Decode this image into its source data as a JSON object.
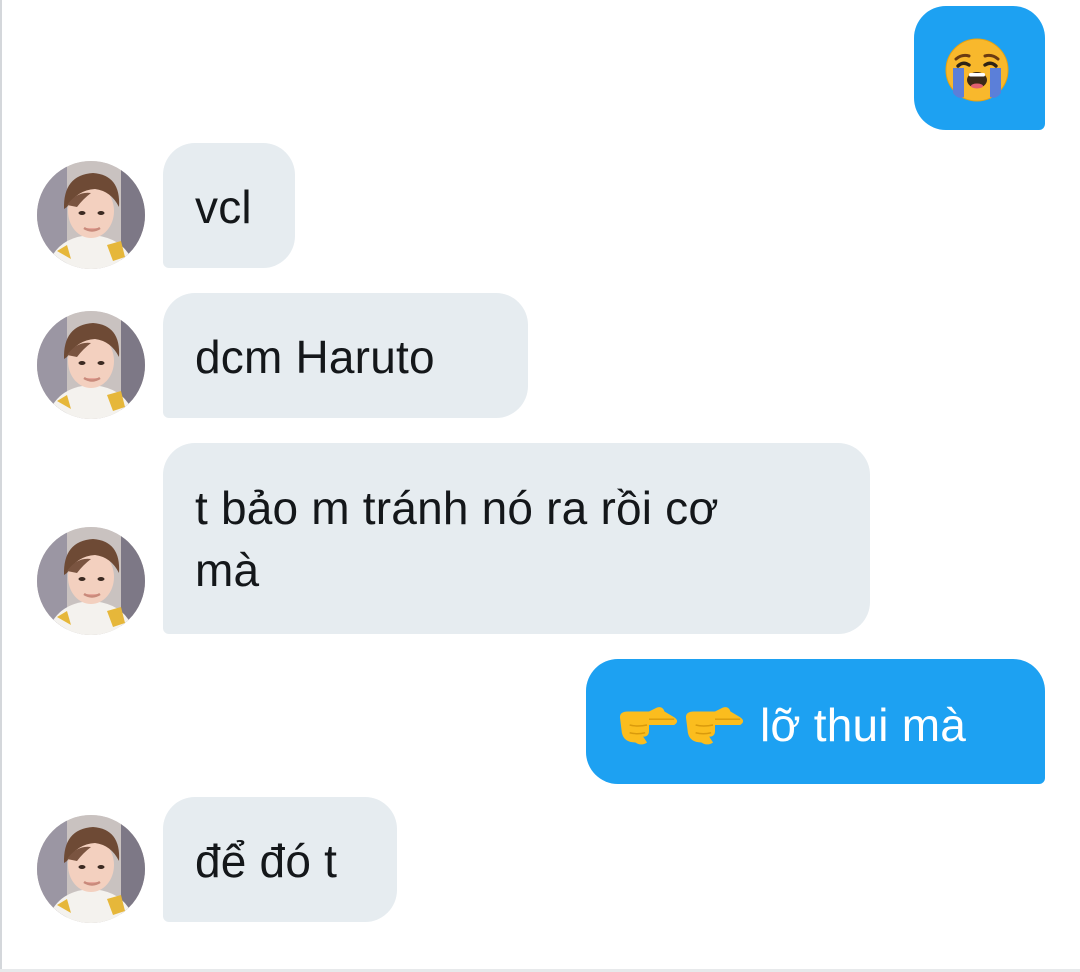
{
  "conversation": {
    "messages": [
      {
        "direction": "outgoing",
        "emoji": "loudly-crying-face"
      },
      {
        "direction": "incoming",
        "text": "vcl"
      },
      {
        "direction": "incoming",
        "text": "dcm Haruto"
      },
      {
        "direction": "incoming",
        "line1": "t bảo m tránh nó ra rồi cơ",
        "line2": "mà"
      },
      {
        "direction": "outgoing",
        "emoji": "backhand-index-pointing-right",
        "text": "lỡ thui mà"
      },
      {
        "direction": "incoming",
        "text": "để đó t"
      }
    ]
  },
  "colors": {
    "incoming_bubble": "#e6ecf0",
    "outgoing_bubble": "#1da1f2",
    "incoming_text": "#14171a",
    "outgoing_text": "#ffffff"
  }
}
